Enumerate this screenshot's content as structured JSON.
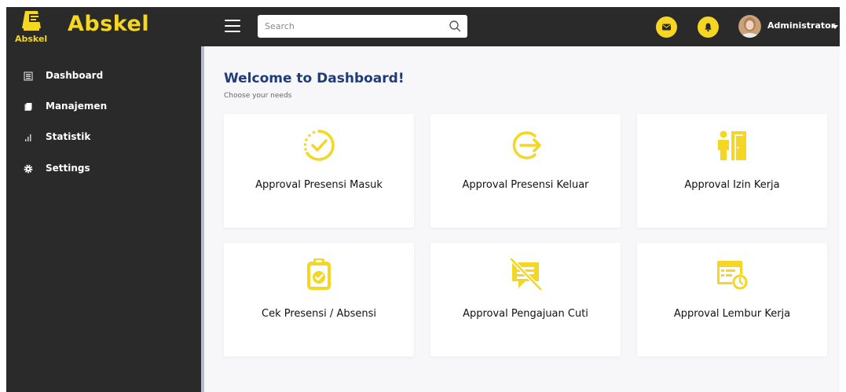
{
  "brand": {
    "name": "Abskel",
    "logo_text": "Abskel"
  },
  "search": {
    "placeholder": "Search"
  },
  "user": {
    "name": "Administrator"
  },
  "sidebar": {
    "items": [
      {
        "label": "Dashboard",
        "icon": "dashboard-icon"
      },
      {
        "label": "Manajemen",
        "icon": "folder-icon"
      },
      {
        "label": "Statistik",
        "icon": "bar-chart-icon"
      },
      {
        "label": "Settings",
        "icon": "gear-icon"
      }
    ]
  },
  "main": {
    "title": "Welcome to Dashboard!",
    "subtitle": "Choose your needs",
    "cards": [
      {
        "label": "Approval Presensi Masuk",
        "icon": "check-in-icon"
      },
      {
        "label": "Approval Presensi Keluar",
        "icon": "logout-icon"
      },
      {
        "label": "Approval Izin Kerja",
        "icon": "door-exit-icon"
      },
      {
        "label": "Cek Presensi / Absensi",
        "icon": "clipboard-check-icon"
      },
      {
        "label": "Approval Pengajuan Cuti",
        "icon": "no-message-icon"
      },
      {
        "label": "Approval Lembur Kerja",
        "icon": "calendar-clock-icon"
      }
    ]
  },
  "colors": {
    "accent": "#f5d623",
    "dark": "#2a2a2a",
    "title": "#1f3b7a",
    "content_bg": "#f7f7f9"
  }
}
